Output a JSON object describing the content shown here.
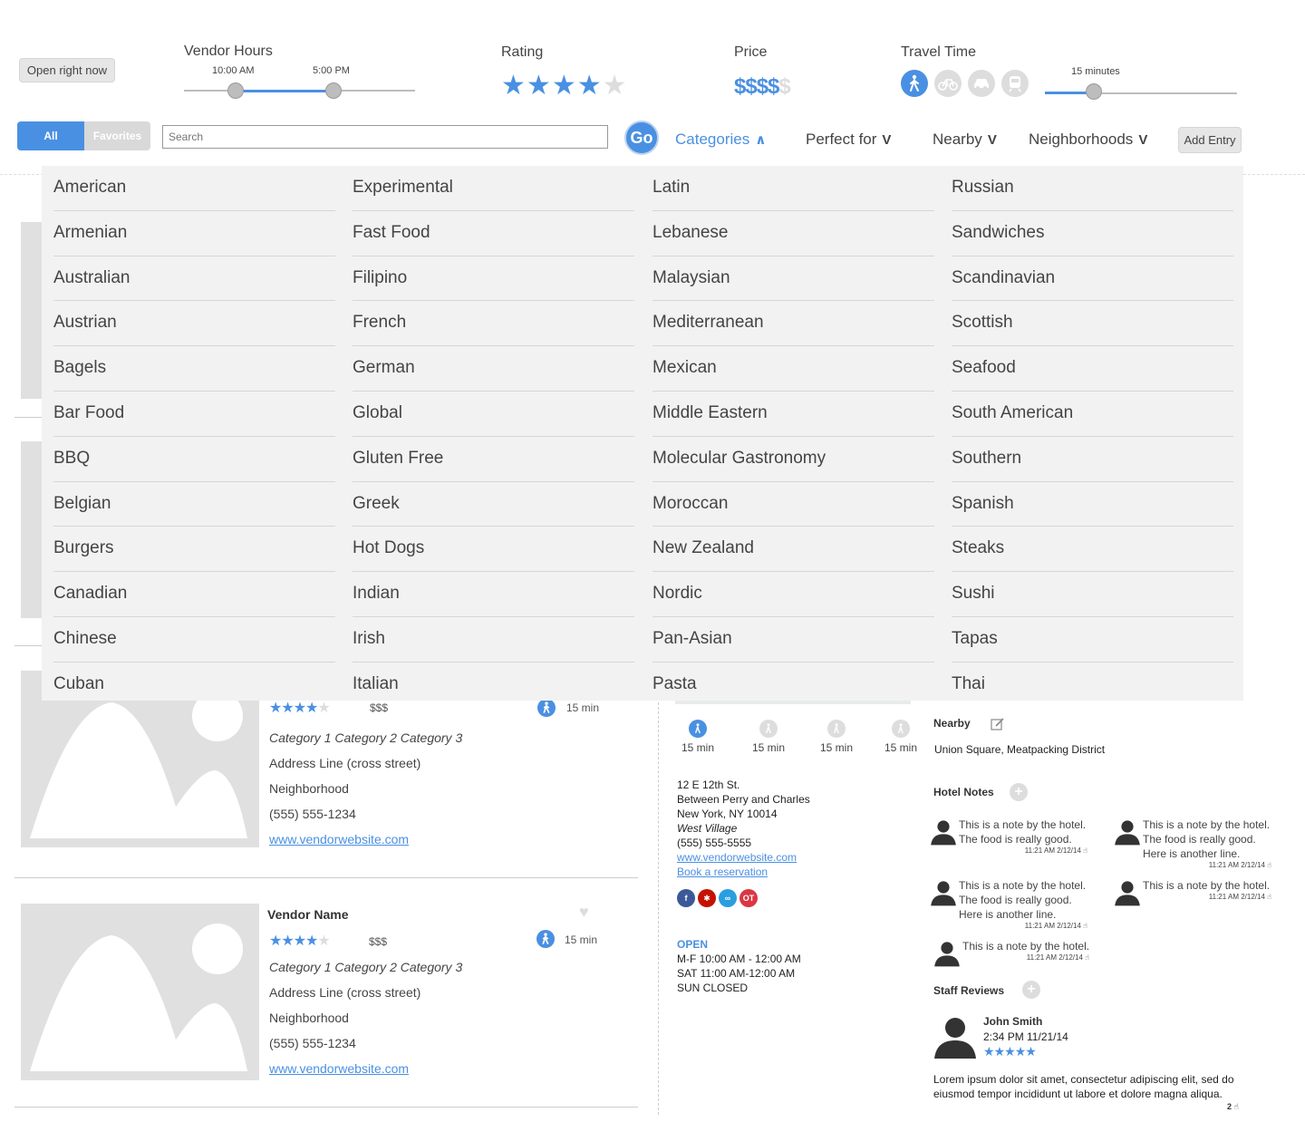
{
  "filters": {
    "open_now": "Open right now",
    "vendor_hours": {
      "label": "Vendor Hours",
      "start": "10:00 AM",
      "end": "5:00 PM"
    },
    "rating": {
      "label": "Rating",
      "value": 4,
      "max": 5
    },
    "price": {
      "label": "Price",
      "active": "$$$$",
      "inactive": "$"
    },
    "travel": {
      "label": "Travel Time",
      "value_label": "15 minutes",
      "modes": [
        "walk-icon",
        "bike-icon",
        "car-icon",
        "train-icon"
      ],
      "active_mode": "walk-icon"
    }
  },
  "nav": {
    "seg_all": "All",
    "seg_favorites": "Favorites",
    "search_placeholder": "Search",
    "go": "Go",
    "categories": "Categories",
    "perfect_for": "Perfect for",
    "nearby": "Nearby",
    "neighborhoods": "Neighborhoods",
    "add_entry": "Add Entry"
  },
  "categories": [
    [
      "American",
      "Armenian",
      "Australian",
      "Austrian",
      "Bagels",
      "Bar Food",
      "BBQ",
      "Belgian",
      "Burgers",
      "Canadian",
      "Chinese",
      "Cuban"
    ],
    [
      "Experimental",
      "Fast Food",
      "Filipino",
      "French",
      "German",
      "Global",
      "Gluten Free",
      "Greek",
      "Hot Dogs",
      "Indian",
      "Irish",
      "Italian"
    ],
    [
      "Latin",
      "Lebanese",
      "Malaysian",
      "Mediterranean",
      "Mexican",
      "Middle Eastern",
      "Molecular Gastronomy",
      "Moroccan",
      "New Zealand",
      "Nordic",
      "Pan-Asian",
      "Pasta"
    ],
    [
      "Russian",
      "Sandwiches",
      "Scandinavian",
      "Scottish",
      "Seafood",
      "South American",
      "Southern",
      "Spanish",
      "Steaks",
      "Sushi",
      "Tapas",
      "Thai"
    ]
  ],
  "listing_a": {
    "rating": 4,
    "price": "$$$",
    "travel": "15 min",
    "categories": "Category 1 Category 2 Category 3",
    "address": "Address Line (cross street)",
    "neighborhood": "Neighborhood",
    "phone": "(555) 555-1234",
    "website": "www.vendorwebsite.com"
  },
  "listing_b": {
    "name": "Vendor Name",
    "rating": 4,
    "price": "$$$",
    "travel": "15 min",
    "categories": "Category 1 Category 2 Category 3",
    "address": "Address Line (cross street)",
    "neighborhood": "Neighborhood",
    "phone": "(555) 555-1234",
    "website": "www.vendorwebsite.com"
  },
  "detail": {
    "travel": [
      "15 min",
      "15 min",
      "15 min",
      "15 min"
    ],
    "address1": "12 E 12th St.",
    "address2": "Between Perry and Charles",
    "address3": "New York, NY 10014",
    "neighborhood": "West Village",
    "phone": "(555) 555-5555",
    "website": "www.vendorwebsite.com",
    "reservation": "Book a reservation",
    "social": [
      {
        "label": "f",
        "color": "#3b5998"
      },
      {
        "label": "✱",
        "color": "#c41200"
      },
      {
        "label": "∞",
        "color": "#2a9ee0"
      },
      {
        "label": "OT",
        "color": "#da3743"
      }
    ],
    "open_label": "OPEN",
    "hours1": "M-F 10:00 AM - 12:00 AM",
    "hours2": "SAT 11:00 AM-12:00 AM",
    "hours3": "SUN CLOSED",
    "nearby_label": "Nearby",
    "nearby_value": "Union Square, Meatpacking District",
    "hotel_notes_label": "Hotel Notes",
    "notes": [
      {
        "l1": "This is a note by the hotel.",
        "l2": "The food is really good.",
        "l3": "",
        "ts": "11:21 AM 2/12/14"
      },
      {
        "l1": "This is a note by the hotel.",
        "l2": "The food is really good.",
        "l3": "Here is another line.",
        "ts": "11:21 AM 2/12/14"
      },
      {
        "l1": "This is a note by the hotel.",
        "l2": "The food is really good.",
        "l3": "Here is another line.",
        "ts": "11:21 AM 2/12/14"
      },
      {
        "l1": "This is a note by the hotel.",
        "l2": "",
        "l3": "",
        "ts": "11:21 AM 2/12/14"
      },
      {
        "l1": "This is a note by the hotel.",
        "l2": "",
        "l3": "",
        "ts": "11:21 AM 2/12/14"
      }
    ],
    "staff_reviews_label": "Staff Reviews",
    "review": {
      "name": "John Smith",
      "time": "2:34 PM 11/21/14",
      "rating": 5,
      "text1": "Lorem ipsum dolor sit amet, consectetur adipiscing elit, sed do",
      "text2": "eiusmod tempor incididunt ut labore et dolore magna aliqua.",
      "likes": "2"
    }
  },
  "colors": {
    "accent": "#4a90e2",
    "dropdown_bg": "#f2f2f2",
    "placeholder": "#e0e0e0"
  }
}
